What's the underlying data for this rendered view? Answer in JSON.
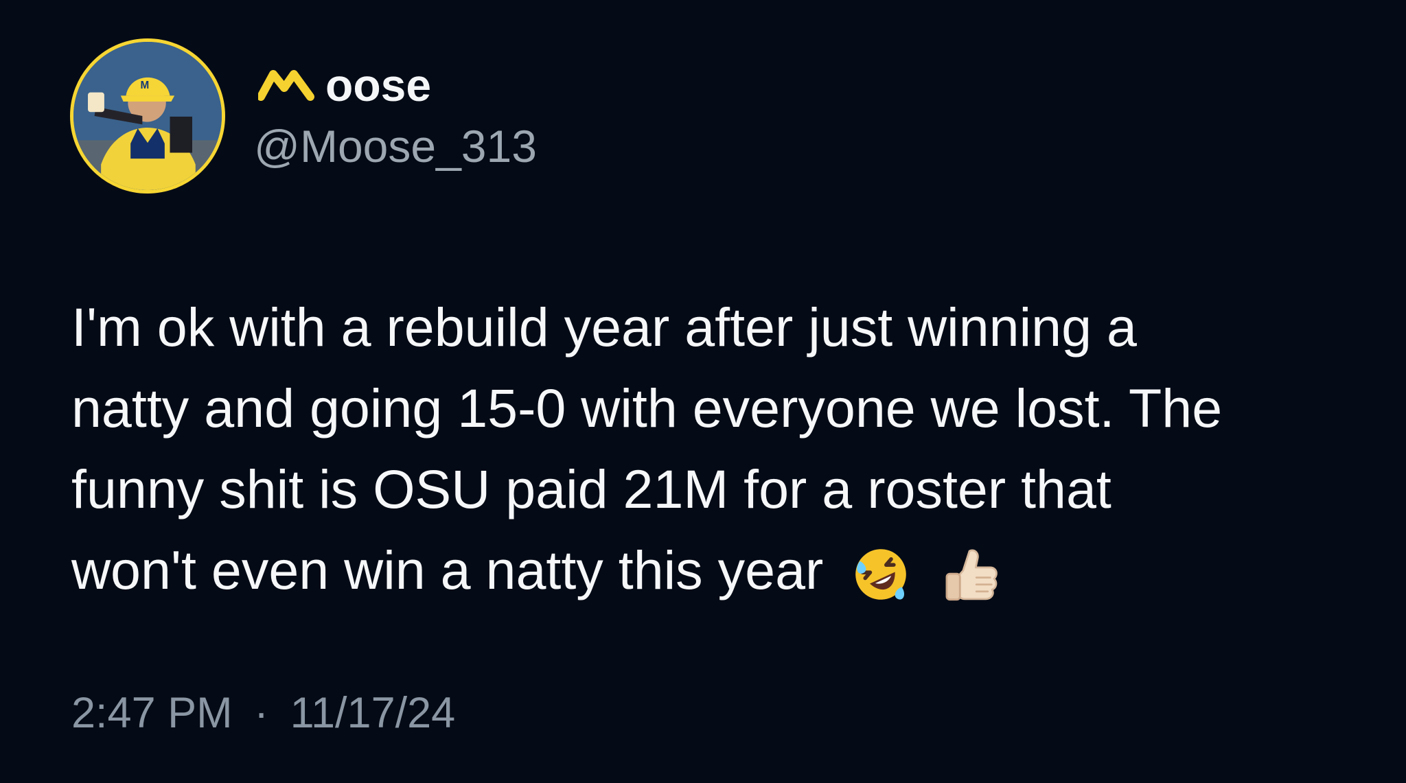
{
  "tweet": {
    "author": {
      "display_name_suffix": "oose",
      "handle": "@Moose_313"
    },
    "text_lines": [
      "I'm ok with a rebuild year after just winning a",
      "natty and going 15-0 with everyone we lost. The",
      "funny shit is OSU paid 21M for a roster that",
      "won't even win a natty this year"
    ],
    "emojis": [
      "rolling-on-floor-laughing-icon",
      "thumbs-up-icon"
    ],
    "time": "2:47 PM",
    "separator": "·",
    "date": "11/17/24"
  },
  "colors": {
    "background": "#050b16",
    "text": "#f6f7f8",
    "secondary_text": "#9ca7b2",
    "avatar_ring": "#f7d633"
  }
}
